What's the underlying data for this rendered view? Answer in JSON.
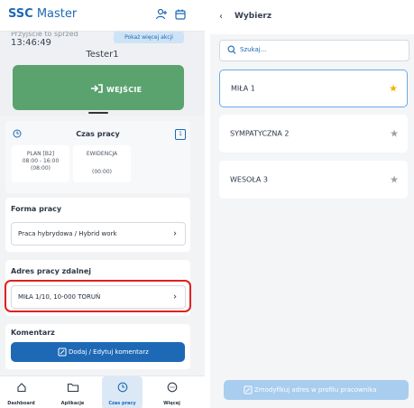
{
  "left": {
    "brand_bold": "SSC",
    "brand_rest": " Master",
    "header": {
      "cut_text": "Przyjście to sprzed",
      "time": "13:46:49",
      "more_actions": "Pokaż więcej akcji",
      "username": "Tester1",
      "enter_button": "WEJŚCIE"
    },
    "work_time": {
      "title": "Czas pracy",
      "badge": "1",
      "plan": {
        "line1": "PLAN [B2]",
        "line2": "08:00 - 16:00",
        "line3": "(08:00)"
      },
      "record": {
        "line1": "EWIDENCJA",
        "line2": "",
        "line3": "(00:00)"
      }
    },
    "work_form": {
      "title": "Forma pracy",
      "value": "Praca hybrydowa / Hybrid work"
    },
    "remote_address": {
      "title": "Adres pracy zdalnej",
      "value": "MIŁA 1/10, 10-000 TORUŃ"
    },
    "comment": {
      "title": "Komentarz",
      "button": "Dodaj / Edytuj komentarz"
    },
    "nav": [
      {
        "label": "Dashboard",
        "icon": "home-icon"
      },
      {
        "label": "Aplikacje",
        "icon": "folder-icon"
      },
      {
        "label": "Czas pracy",
        "icon": "clock-icon"
      },
      {
        "label": "Więcej",
        "icon": "more-icon"
      }
    ],
    "colors": {
      "brand": "#1e69b6",
      "enter": "#5aa36f",
      "highlight": "#e02020"
    }
  },
  "right": {
    "title": "Wybierz",
    "search_placeholder": "Szukaj...",
    "items": [
      {
        "name": "MIŁA 1",
        "favorite": true
      },
      {
        "name": "SYMPATYCZNA 2",
        "favorite": false
      },
      {
        "name": "WESOŁA 3",
        "favorite": false
      }
    ],
    "modify_button": "Zmodyfikuj adres w profilu pracownika",
    "colors": {
      "star_active": "#f5b400",
      "star_inactive": "#9aa1a8"
    }
  }
}
